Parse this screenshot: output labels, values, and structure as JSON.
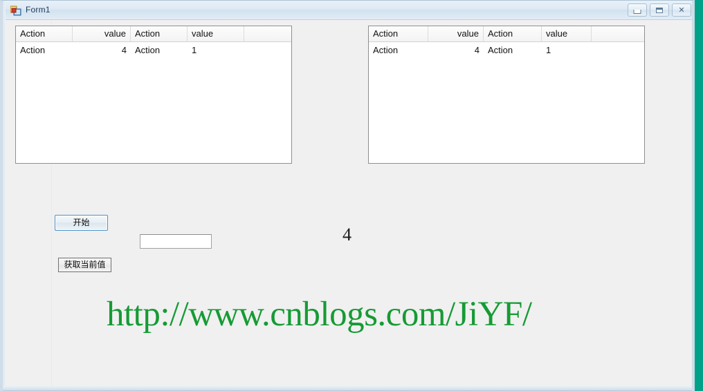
{
  "window": {
    "title": "Form1",
    "icon": "winforms-icon",
    "controls": [
      {
        "name": "minimize-button",
        "glyph": "minimize-icon",
        "label": "Minimize"
      },
      {
        "name": "maximize-button",
        "glyph": "maximize-icon",
        "label": "Maximize"
      },
      {
        "name": "close-button",
        "glyph": "close-icon",
        "label": "Close"
      }
    ],
    "close_glyph": "✕"
  },
  "grids": [
    {
      "name": "left-data-grid",
      "columns": [
        {
          "header": "Action",
          "align": "left"
        },
        {
          "header": "value",
          "align": "right"
        },
        {
          "header": "Action",
          "align": "left"
        },
        {
          "header": "value",
          "align": "left"
        },
        {
          "header": "",
          "align": "left"
        }
      ],
      "rows": [
        [
          "Action",
          "4",
          "Action",
          "1",
          ""
        ]
      ]
    },
    {
      "name": "right-data-grid",
      "columns": [
        {
          "header": "Action",
          "align": "left"
        },
        {
          "header": "value",
          "align": "right"
        },
        {
          "header": "Action",
          "align": "left"
        },
        {
          "header": "value",
          "align": "left"
        },
        {
          "header": "",
          "align": "left"
        }
      ],
      "rows": [
        [
          "Action",
          "4",
          "Action",
          "1",
          ""
        ]
      ]
    }
  ],
  "controls": {
    "start_button": "开始",
    "get_current_value_button": "获取当前值",
    "input_value": "",
    "input_placeholder": "",
    "counter_label": "4",
    "url_label": "http://www.cnblogs.com/JiYF/"
  },
  "colors": {
    "desktop_background": "#00a188",
    "form_background": "#f0f0f0",
    "url_text": "#159b34",
    "focus_border": "#4a90c4",
    "grid_border": "#8e8e8e"
  }
}
